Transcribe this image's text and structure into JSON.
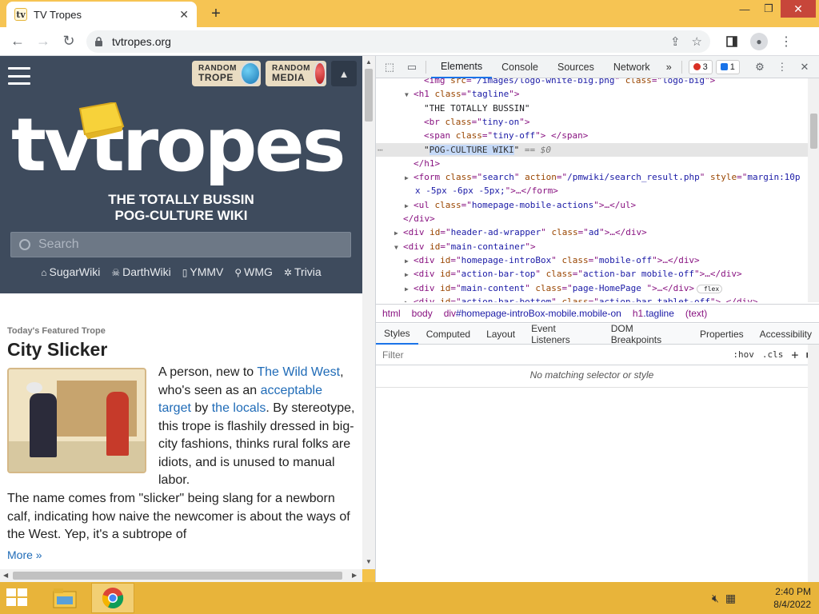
{
  "browser": {
    "tab_title": "TV Tropes",
    "tab_favicon": "tv",
    "new_tab_icon": "+",
    "url": "tvtropes.org",
    "window_controls": {
      "minimize": "—",
      "maximize": "❐",
      "close": "✕"
    }
  },
  "site": {
    "random_trope_label_1": "RANDOM",
    "random_trope_label_2": "TROPE",
    "random_media_label_1": "RANDOM",
    "random_media_label_2": "MEDIA",
    "logo_text": "tvtropes",
    "tagline_1": "THE TOTALLY BUSSIN",
    "tagline_2": "POG-CULTURE WIKI",
    "search_placeholder": "Search",
    "wiki_links": [
      "SugarWiki",
      "DarthWiki",
      "YMMV",
      "WMG",
      "Trivia"
    ],
    "featured_label": "Today's Featured Trope",
    "featured_title": "City Slicker",
    "featured_p1_a": "A person, new to ",
    "featured_p1_link1": "The Wild West",
    "featured_p1_b": ", who's seen as an ",
    "featured_p1_link2": "acceptable target",
    "featured_p1_c": " by ",
    "featured_p1_link3": "the locals",
    "featured_p1_d": ". By stereotype, this trope is flashily dressed in big-city fashions, thinks rural folks are idiots, and is unused to manual labor.",
    "featured_p2": "The name comes from \"slicker\" being slang for a newborn calf, indicating how naive the newcomer is about the ways of the West. Yep, it's a subtrope of",
    "more_link": "More »"
  },
  "devtools": {
    "tabs": [
      "Elements",
      "Console",
      "Sources",
      "Network"
    ],
    "active_tab": "Elements",
    "more_tabs": "»",
    "error_count": "3",
    "message_count": "1",
    "dom_lines": [
      {
        "indent": 3,
        "arrow": "",
        "parts": [
          [
            "tg",
            "<img "
          ],
          [
            "at",
            "src"
          ],
          [
            "tg",
            "=\""
          ],
          [
            "av",
            "/images/logo-white-big.png"
          ],
          [
            "tg",
            "\" "
          ],
          [
            "at",
            "class"
          ],
          [
            "tg",
            "=\""
          ],
          [
            "av",
            "logo-big"
          ],
          [
            "tg",
            "\">"
          ]
        ]
      },
      {
        "indent": 2,
        "arrow": "▼",
        "parts": [
          [
            "tg",
            "<h1 "
          ],
          [
            "at",
            "class"
          ],
          [
            "tg",
            "=\""
          ],
          [
            "av",
            "tagline"
          ],
          [
            "tg",
            "\">"
          ]
        ]
      },
      {
        "indent": 3,
        "arrow": "",
        "parts": [
          [
            "tx",
            "\"THE TOTALLY BUSSIN\""
          ]
        ]
      },
      {
        "indent": 3,
        "arrow": "",
        "parts": [
          [
            "tg",
            "<br "
          ],
          [
            "at",
            "class"
          ],
          [
            "tg",
            "=\""
          ],
          [
            "av",
            "tiny-on"
          ],
          [
            "tg",
            "\">"
          ]
        ]
      },
      {
        "indent": 3,
        "arrow": "",
        "parts": [
          [
            "tg",
            "<span "
          ],
          [
            "at",
            "class"
          ],
          [
            "tg",
            "=\""
          ],
          [
            "av",
            "tiny-off"
          ],
          [
            "tg",
            "\"> </span>"
          ]
        ]
      },
      {
        "indent": 3,
        "arrow": "",
        "sel": true,
        "parts": [
          [
            "tx",
            "\""
          ],
          [
            "hl",
            "POG-CULTURE WIKI"
          ],
          [
            "tx",
            "\" "
          ],
          [
            "cm",
            "== $0"
          ]
        ]
      },
      {
        "indent": 2,
        "arrow": "",
        "parts": [
          [
            "tg",
            "</h1>"
          ]
        ]
      },
      {
        "indent": 2,
        "arrow": "▶",
        "parts": [
          [
            "tg",
            "<form "
          ],
          [
            "at",
            "class"
          ],
          [
            "tg",
            "=\""
          ],
          [
            "av",
            "search"
          ],
          [
            "tg",
            "\" "
          ],
          [
            "at",
            "action"
          ],
          [
            "tg",
            "=\""
          ],
          [
            "av",
            "/pmwiki/search_result.php"
          ],
          [
            "tg",
            "\" "
          ],
          [
            "at",
            "style"
          ],
          [
            "tg",
            "=\""
          ],
          [
            "av",
            "margin:10p"
          ]
        ]
      },
      {
        "indent": 0,
        "arrow": "",
        "cont": true,
        "parts": [
          [
            "av",
            "x -5px -6px -5px;"
          ],
          [
            "tg",
            "\">…</form>"
          ]
        ]
      },
      {
        "indent": 2,
        "arrow": "▶",
        "parts": [
          [
            "tg",
            "<ul "
          ],
          [
            "at",
            "class"
          ],
          [
            "tg",
            "=\""
          ],
          [
            "av",
            "homepage-mobile-actions"
          ],
          [
            "tg",
            "\">…</ul>"
          ]
        ]
      },
      {
        "indent": 1,
        "arrow": "",
        "parts": [
          [
            "tg",
            "</div>"
          ]
        ]
      },
      {
        "indent": 1,
        "arrow": "▶",
        "parts": [
          [
            "tg",
            "<div "
          ],
          [
            "at",
            "id"
          ],
          [
            "tg",
            "=\""
          ],
          [
            "av",
            "header-ad-wrapper"
          ],
          [
            "tg",
            "\" "
          ],
          [
            "at",
            "class"
          ],
          [
            "tg",
            "=\""
          ],
          [
            "av",
            "ad"
          ],
          [
            "tg",
            "\">…</div>"
          ]
        ]
      },
      {
        "indent": 1,
        "arrow": "▼",
        "parts": [
          [
            "tg",
            "<div "
          ],
          [
            "at",
            "id"
          ],
          [
            "tg",
            "=\""
          ],
          [
            "av",
            "main-container"
          ],
          [
            "tg",
            "\">"
          ]
        ]
      },
      {
        "indent": 2,
        "arrow": "▶",
        "parts": [
          [
            "tg",
            "<div "
          ],
          [
            "at",
            "id"
          ],
          [
            "tg",
            "=\""
          ],
          [
            "av",
            "homepage-introBox"
          ],
          [
            "tg",
            "\" "
          ],
          [
            "at",
            "class"
          ],
          [
            "tg",
            "=\""
          ],
          [
            "av",
            "mobile-off"
          ],
          [
            "tg",
            "\">…</div>"
          ]
        ]
      },
      {
        "indent": 2,
        "arrow": "▶",
        "parts": [
          [
            "tg",
            "<div "
          ],
          [
            "at",
            "id"
          ],
          [
            "tg",
            "=\""
          ],
          [
            "av",
            "action-bar-top"
          ],
          [
            "tg",
            "\" "
          ],
          [
            "at",
            "class"
          ],
          [
            "tg",
            "=\""
          ],
          [
            "av",
            "action-bar mobile-off"
          ],
          [
            "tg",
            "\">…</div>"
          ]
        ]
      },
      {
        "indent": 2,
        "arrow": "▶",
        "parts": [
          [
            "tg",
            "<div "
          ],
          [
            "at",
            "id"
          ],
          [
            "tg",
            "=\""
          ],
          [
            "av",
            "main-content"
          ],
          [
            "tg",
            "\" "
          ],
          [
            "at",
            "class"
          ],
          [
            "tg",
            "=\""
          ],
          [
            "av",
            "page-HomePage "
          ],
          [
            "tg",
            "\">…</div>"
          ],
          [
            "fx",
            " flex"
          ]
        ]
      },
      {
        "indent": 2,
        "arrow": "▶",
        "parts": [
          [
            "tg",
            "<div "
          ],
          [
            "at",
            "id"
          ],
          [
            "tg",
            "=\""
          ],
          [
            "av",
            "action-bar-bottom"
          ],
          [
            "tg",
            "\" "
          ],
          [
            "at",
            "class"
          ],
          [
            "tg",
            "=\""
          ],
          [
            "av",
            "action-bar tablet-off"
          ],
          [
            "tg",
            "\">…</div>"
          ]
        ]
      }
    ],
    "breadcrumbs": [
      {
        "tag": "html",
        "rest": ""
      },
      {
        "tag": "body",
        "rest": ""
      },
      {
        "tag": "div",
        "rest": "#homepage-introBox-mobile.mobile-on"
      },
      {
        "tag": "h1",
        "rest": ".tagline"
      },
      {
        "tag": "(text)",
        "rest": ""
      }
    ],
    "style_tabs": [
      "Styles",
      "Computed",
      "Layout",
      "Event Listeners",
      "DOM Breakpoints",
      "Properties",
      "Accessibility"
    ],
    "active_style_tab": "Styles",
    "filter_placeholder": "Filter",
    "hov": ":hov",
    "cls": ".cls",
    "no_match": "No matching selector or style"
  },
  "taskbar": {
    "time": "2:40 PM",
    "date": "8/4/2022"
  },
  "colors": {
    "header_bg": "#3e4b5d",
    "link": "#1f6bb7",
    "accent": "#1a73e8",
    "titlebar": "#f6c453"
  }
}
